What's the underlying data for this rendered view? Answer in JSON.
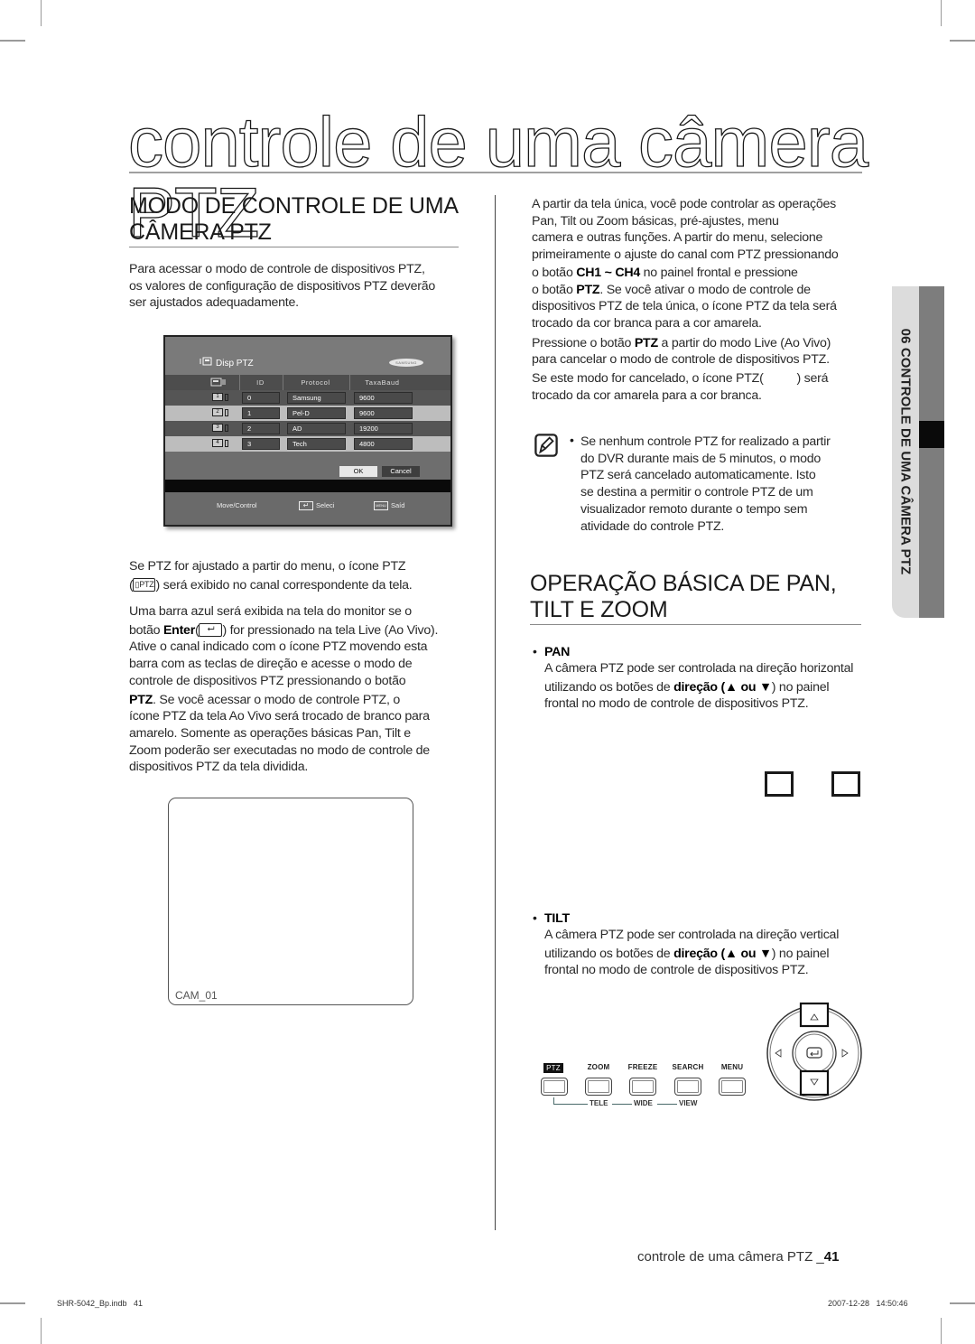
{
  "page": {
    "title": "controle de uma câmera PTZ",
    "footer": {
      "label": "controle de uma câmera PTZ _",
      "page_number": "41"
    },
    "slug": {
      "file": "SHR-5042_Bp.indb   41",
      "datetime": "2007-12-28   14:50:46"
    }
  },
  "side_tab": {
    "label": "06 CONTROLE DE UMA CÂMERA PTZ"
  },
  "left_column": {
    "section_heading_line1": "MODO DE CONTROLE DE UMA",
    "section_heading_line2": "CÂMERA PTZ",
    "intro": [
      "Para acessar o modo de controle de dispositivos PTZ,",
      "os valores de configuração de dispositivos PTZ deverão",
      "ser ajustados adequadamente."
    ],
    "dvr_menu": {
      "title": "Disp PTZ",
      "brand": "SAMSUNG",
      "columns": [
        "ID",
        "Protocol",
        "TaxaBaud"
      ],
      "rows": [
        {
          "channel": "1",
          "id": "0",
          "protocol": "Samsung",
          "baud": "9600"
        },
        {
          "channel": "2",
          "id": "1",
          "protocol": "Pel-D",
          "baud": "9600"
        },
        {
          "channel": "3",
          "id": "2",
          "protocol": "AD",
          "baud": "19200"
        },
        {
          "channel": "4",
          "id": "3",
          "protocol": "Tech",
          "baud": "4800"
        }
      ],
      "ok_label": "OK",
      "cancel_label": "Cancel",
      "footer": {
        "move": "Move/Control",
        "select": "Seleci",
        "menu_key": "MENU",
        "exit": "Saíd"
      }
    },
    "para1_line1": "Se PTZ for ajustado a partir do menu, o ícone PTZ",
    "para1_icon": "PTZ",
    "para1_line2": ") será exibido no canal correspondente da tela.",
    "para2_line1": "Uma barra azul será exibida na tela do monitor se o",
    "para2_pre": "botão ",
    "para2_bold": "Enter",
    "para2_post": ") for pressionado na tela Live (Ao Vivo).",
    "para2_rest": [
      "Ative o canal indicado com o ícone PTZ movendo esta",
      "barra com as teclas de direção e acesse o modo de",
      "controle de dispositivos PTZ pressionando o botão"
    ],
    "para3_bold": "PTZ",
    "para3_first": ". Se você acessar o modo de controle PTZ, o",
    "para3_rest": [
      "ícone PTZ da tela Ao Vivo será trocado de branco para",
      "amarelo. Somente as operações básicas Pan, Tilt e",
      "Zoom poderão ser executadas no modo de controle de",
      "dispositivos PTZ da tela dividida."
    ],
    "cam_preview_label": "CAM_01"
  },
  "right_column": {
    "intro_lines": [
      "A partir da tela única, você pode controlar as operações",
      "Pan, Tilt ou Zoom básicas, pré-ajustes, menu",
      "camera e outras funções. A partir do menu, selecione",
      "primeiramente o ajuste do canal com PTZ pressionando"
    ],
    "ch_pre": "o botão ",
    "ch_bold": "CH1 ~ CH4",
    "ch_post": " no painel frontal e pressione",
    "ptz_pre": "o botão ",
    "ptz_bold": "PTZ",
    "ptz_post": ". Se você ativar o modo de controle de",
    "intro_rest": [
      "dispositivos PTZ de tela única, o ícone PTZ da tela será",
      "trocado da cor branca para a cor amarela."
    ],
    "press_pre": "Pressione o botão ",
    "press_bold": "PTZ",
    "press_post": " a partir do modo Live (Ao Vivo)",
    "press_line2": "para cancelar o modo de controle de dispositivos PTZ.",
    "cancel_line1": "Se este modo for cancelado, o ícone PTZ(          ) será",
    "cancel_line2": "trocado da cor amarela para a cor branca.",
    "note_lines": [
      "Se nenhum controle PTZ for realizado a partir",
      "do DVR durante mais de 5 minutos, o modo",
      "PTZ será cancelado automaticamente. Isto",
      "se destina a permitir o controle PTZ de um",
      "visualizador remoto durante o tempo sem",
      "atividade do controle PTZ."
    ],
    "section_heading_line1": "OPERAÇÃO BÁSICA DE PAN,",
    "section_heading_line2": "TILT E ZOOM",
    "pan": {
      "label": "PAN",
      "line1": "A câmera PTZ pode ser controlada na direção horizontal",
      "line2_pre": "utilizando os botões de ",
      "line2_bold": "direção (▲ ou ▼",
      "line2_post": ") no painel",
      "line3": "frontal no modo de controle de dispositivos PTZ."
    },
    "tilt": {
      "label": "TILT",
      "line1": "A câmera PTZ pode ser controlada na direção vertical",
      "line2_pre": "utilizando os botões de ",
      "line2_bold": "direção (▲ ou ▼",
      "line2_post": ") no painel",
      "line3": "frontal no modo de controle de dispositivos PTZ."
    },
    "front_panel": {
      "buttons": [
        "PTZ",
        "ZOOM",
        "FREEZE",
        "SEARCH",
        "MENU"
      ],
      "sub_labels": [
        "TELE",
        "WIDE",
        "VIEW"
      ],
      "arrows": {
        "up": "△",
        "down": "▽",
        "left": "◁",
        "right": "▷",
        "enter": "↵"
      }
    }
  }
}
